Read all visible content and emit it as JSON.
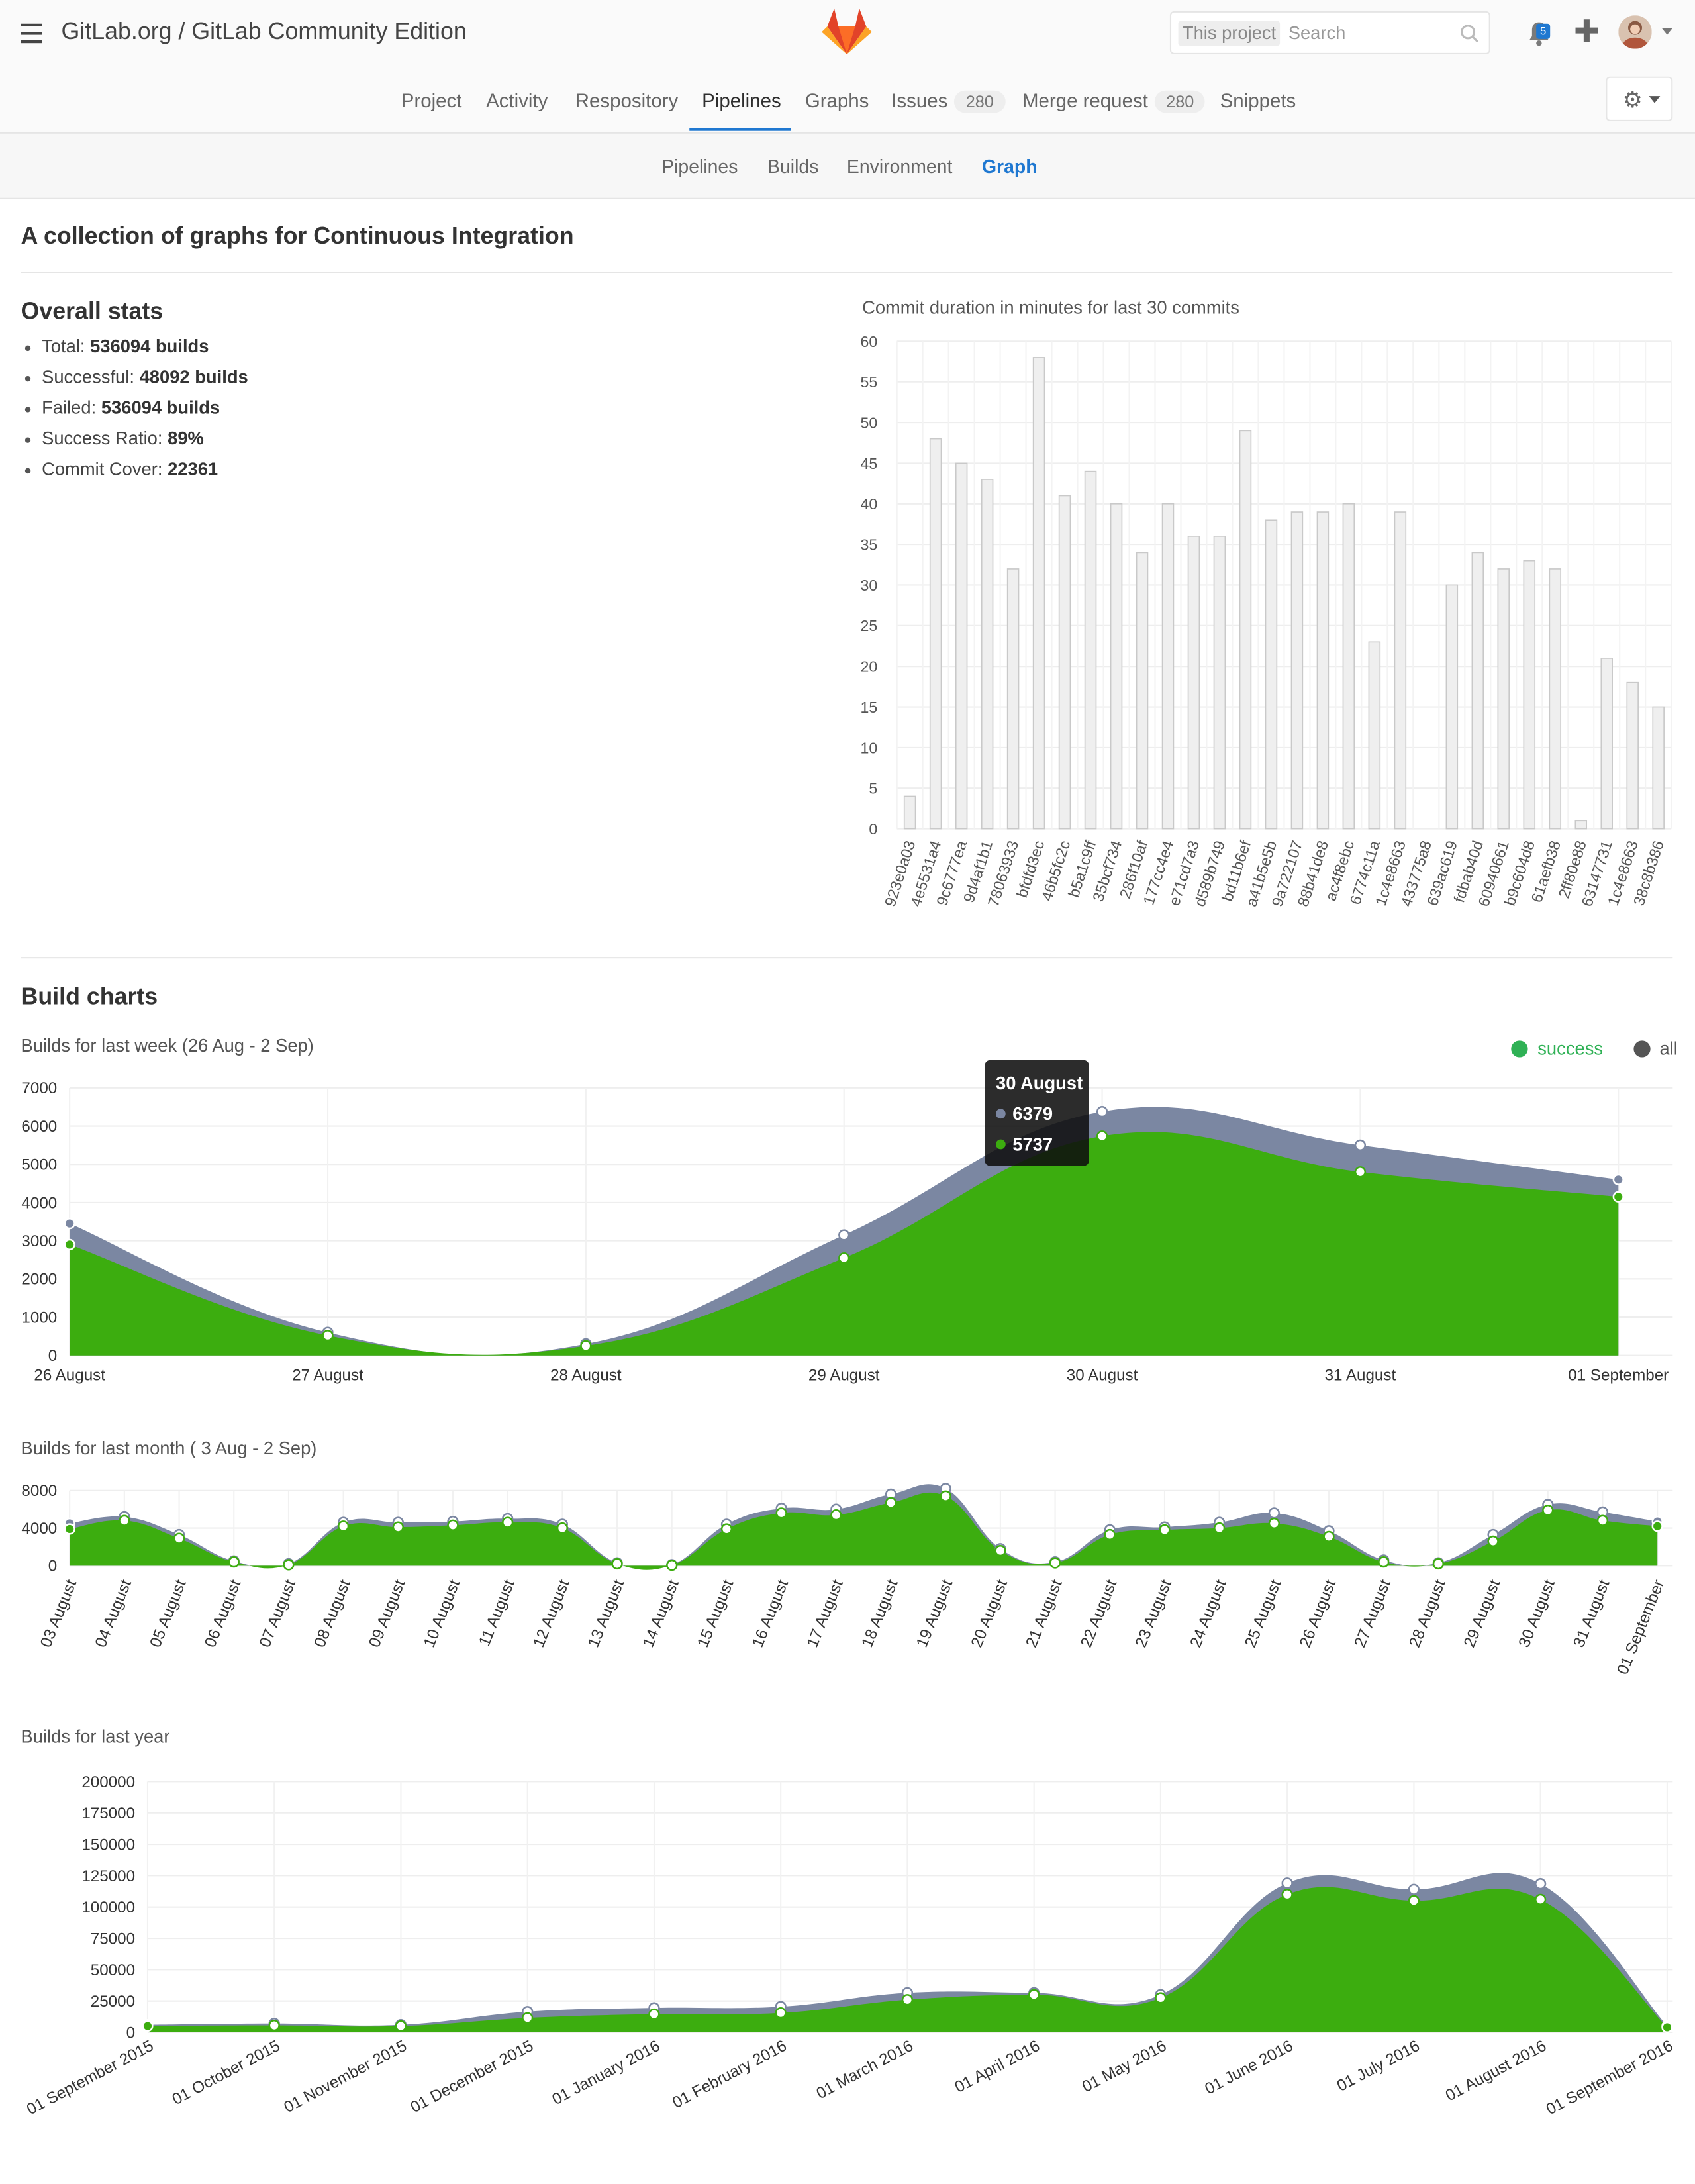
{
  "app": {
    "title": "GitLab.org / GitLab Community Edition"
  },
  "search": {
    "scope": "This project",
    "placeholder": "Search"
  },
  "notifications": {
    "count": "5"
  },
  "nav": {
    "tabs": [
      {
        "label": "Project"
      },
      {
        "label": "Activity"
      },
      {
        "label": "Respository"
      },
      {
        "label": "Pipelines"
      },
      {
        "label": "Graphs"
      },
      {
        "label": "Issues",
        "count": "280"
      },
      {
        "label": "Merge request",
        "count": "280"
      },
      {
        "label": "Snippets"
      }
    ],
    "active": "Pipelines"
  },
  "subnav": {
    "tabs": [
      {
        "label": "Pipelines"
      },
      {
        "label": "Builds"
      },
      {
        "label": "Environment"
      },
      {
        "label": "Graph"
      }
    ],
    "active": "Graph"
  },
  "page": {
    "title": "A collection of graphs for Continuous Integration",
    "overall_title": "Overall stats",
    "stats": [
      {
        "label": "Total:",
        "value": "536094 builds"
      },
      {
        "label": "Successful:",
        "value": "48092 builds"
      },
      {
        "label": "Failed:",
        "value": "536094 builds"
      },
      {
        "label": "Success Ratio:",
        "value": "89%"
      },
      {
        "label": "Commit Cover:",
        "value": "22361"
      }
    ],
    "build_charts_title": "Build charts"
  },
  "colors": {
    "success": "#3cad0f",
    "all": "#7b87a2",
    "bar_fill": "#efefef",
    "bar_stroke": "#c9c9c9",
    "link": "#1f78d1"
  },
  "legend": {
    "success": "success",
    "all": "all",
    "success_color": "#2fb155",
    "all_color": "#555555"
  },
  "tooltip": {
    "title": "30 August",
    "all": "6379",
    "success": "5737"
  },
  "chart_data": [
    {
      "type": "bar",
      "title": "Commit duration in minutes for last 30 commits",
      "categories": [
        "923e0a03",
        "4e5531a4",
        "9c6777ea",
        "9d4af1b1",
        "78063933",
        "bfdfd3ec",
        "46b5fc2c",
        "b5a1c9ff",
        "35bcf734",
        "286f10af",
        "177cc4e4",
        "e71cd7a3",
        "d589b749",
        "bd11b6ef",
        "a41b5e5b",
        "9a722107",
        "88b41de8",
        "ac4f8ebc",
        "6774c11a",
        "1c4e8663",
        "433775a8",
        "639ac619",
        "fdbab40d",
        "60940661",
        "b9c604d8",
        "61aefb38",
        "2ff80e88",
        "63147731",
        "1c4e8663",
        "38c8b386"
      ],
      "values": [
        4,
        48,
        45,
        43,
        32,
        58,
        41,
        44,
        40,
        34,
        40,
        36,
        36,
        49,
        38,
        39,
        39,
        40,
        23,
        39,
        0,
        30,
        34,
        32,
        33,
        32,
        1,
        21,
        18,
        15
      ],
      "ylim": [
        0,
        60
      ],
      "yticks": [
        0,
        5,
        10,
        15,
        20,
        25,
        30,
        35,
        40,
        45,
        50,
        55,
        60
      ],
      "ytick_labels": [
        "0",
        "5",
        "10",
        "15",
        "20",
        "25",
        "30",
        "35",
        "40",
        "45",
        "50",
        "55",
        "60"
      ],
      "grid": true
    },
    {
      "type": "area",
      "title": "Builds for last week (26 Aug - 2 Sep)",
      "categories": [
        "26 August",
        "27 August",
        "28 August",
        "29 August",
        "30 August",
        "31 August",
        "01 September"
      ],
      "series": [
        {
          "name": "all",
          "values": [
            3450,
            600,
            300,
            3150,
            6379,
            5500,
            4600
          ]
        },
        {
          "name": "success",
          "values": [
            2900,
            520,
            250,
            2550,
            5737,
            4800,
            4150
          ]
        }
      ],
      "ylim": [
        0,
        7000
      ],
      "yticks": [
        0,
        1000,
        2000,
        3000,
        4000,
        5000,
        6000,
        7000
      ],
      "legend": "top-right",
      "grid": true
    },
    {
      "type": "area",
      "title": "Builds for last month ( 3 Aug - 2 Sep)",
      "categories": [
        "03 August",
        "04 August",
        "05 August",
        "06 August",
        "07 August",
        "08 August",
        "09 August",
        "10 August",
        "11 August",
        "12 August",
        "13 August",
        "14 August",
        "15 August",
        "16 August",
        "17 August",
        "18 August",
        "19 August",
        "20 August",
        "21 August",
        "22 August",
        "23 August",
        "24 August",
        "25 August",
        "26 August",
        "27 August",
        "28 August",
        "29 August",
        "30 August",
        "31 August",
        "01 September"
      ],
      "series": [
        {
          "name": "all",
          "values": [
            4500,
            5200,
            3300,
            500,
            200,
            4600,
            4600,
            4700,
            5000,
            4400,
            300,
            100,
            4400,
            6100,
            6000,
            7600,
            8200,
            1800,
            400,
            3800,
            4100,
            4600,
            5600,
            3700,
            600,
            300,
            3300,
            6500,
            5700,
            4700
          ]
        },
        {
          "name": "success",
          "values": [
            3900,
            4800,
            2900,
            400,
            100,
            4200,
            4100,
            4300,
            4600,
            4000,
            200,
            50,
            3900,
            5600,
            5400,
            6700,
            7400,
            1600,
            300,
            3300,
            3800,
            4000,
            4500,
            3100,
            400,
            200,
            2600,
            5900,
            4800,
            4200
          ]
        }
      ],
      "ylim": [
        0,
        8000
      ],
      "yticks": [
        0,
        4000,
        8000
      ],
      "grid": true
    },
    {
      "type": "area",
      "title": "Builds for last year",
      "categories": [
        "01 September 2015",
        "01 October 2015",
        "01 November 2015",
        "01 December 2015",
        "01 January 2016",
        "01 February 2016",
        "01 March 2016",
        "01 April 2016",
        "01 May 2016",
        "01 June 2016",
        "01 July 2016",
        "01 August 2016",
        "01 September 2016"
      ],
      "series": [
        {
          "name": "all",
          "values": [
            6000,
            7000,
            6000,
            16500,
            19500,
            20500,
            31500,
            31500,
            30000,
            119000,
            114000,
            118500,
            5000
          ]
        },
        {
          "name": "success",
          "values": [
            5000,
            5500,
            5000,
            11500,
            14500,
            15500,
            26000,
            30000,
            27500,
            110000,
            105000,
            106000,
            4000
          ]
        }
      ],
      "ylim": [
        0,
        200000
      ],
      "yticks": [
        0,
        25000,
        50000,
        75000,
        100000,
        125000,
        150000,
        175000,
        200000
      ],
      "grid": true
    }
  ]
}
